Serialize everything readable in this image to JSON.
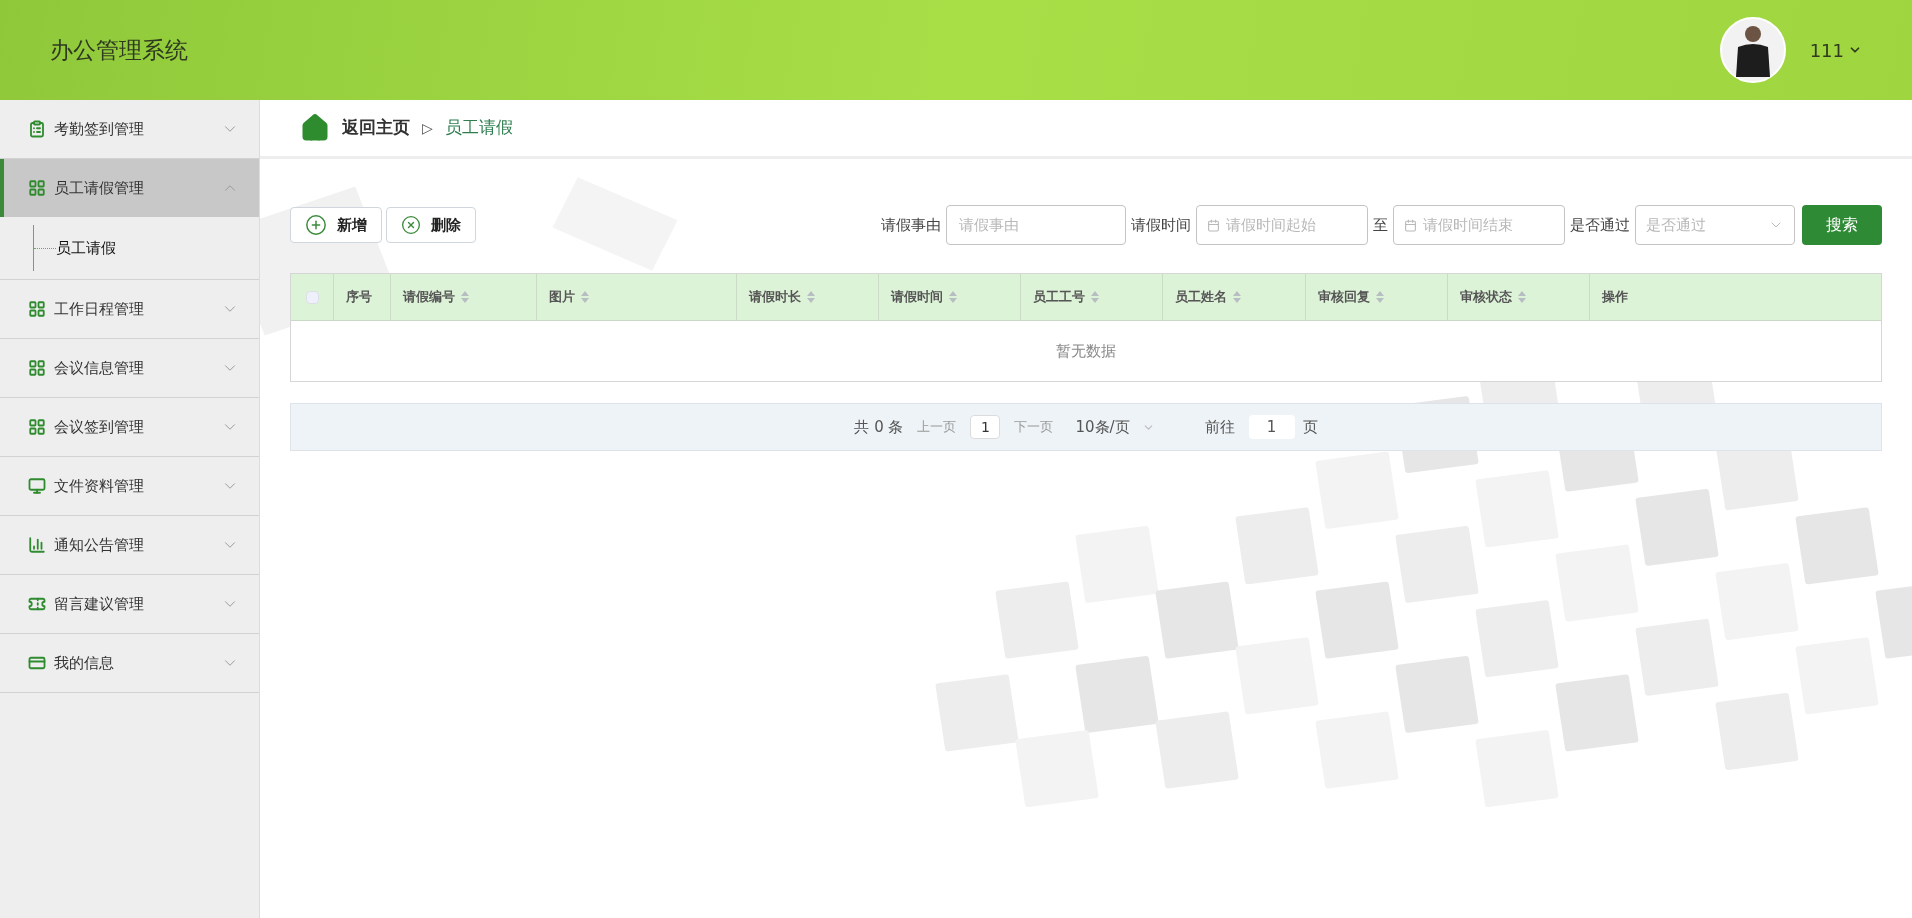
{
  "header": {
    "title": "办公管理系统",
    "user": "111"
  },
  "sidebar": {
    "items": [
      {
        "label": "考勤签到管理",
        "selected": false,
        "expanded": false
      },
      {
        "label": "员工请假管理",
        "selected": true,
        "expanded": true,
        "children": [
          {
            "label": "员工请假",
            "selected": true
          }
        ]
      },
      {
        "label": "工作日程管理",
        "selected": false,
        "expanded": false
      },
      {
        "label": "会议信息管理",
        "selected": false,
        "expanded": false
      },
      {
        "label": "会议签到管理",
        "selected": false,
        "expanded": false
      },
      {
        "label": "文件资料管理",
        "selected": false,
        "expanded": false
      },
      {
        "label": "通知公告管理",
        "selected": false,
        "expanded": false
      },
      {
        "label": "留言建议管理",
        "selected": false,
        "expanded": false
      },
      {
        "label": "我的信息",
        "selected": false,
        "expanded": false
      }
    ]
  },
  "breadcrumb": {
    "home": "返回主页",
    "separator": "▷",
    "current": "员工请假"
  },
  "actions": [
    {
      "kind": "add",
      "label": "新增"
    },
    {
      "kind": "delete",
      "label": "删除"
    }
  ],
  "filters": [
    {
      "kind": "text",
      "label": "请假事由",
      "placeholder": "请假事由"
    },
    {
      "kind": "date",
      "label": "请假时间",
      "placeholder": "请假时间起始"
    },
    {
      "kind": "date",
      "label": "至",
      "placeholder": "请假时间结束"
    },
    {
      "kind": "select",
      "label": "是否通过",
      "placeholder": "是否通过"
    }
  ],
  "search_button": "搜索",
  "table": {
    "columns": [
      {
        "label": "序号",
        "sortable": false
      },
      {
        "label": "请假编号",
        "sortable": true
      },
      {
        "label": "图片",
        "sortable": true
      },
      {
        "label": "请假时长",
        "sortable": true
      },
      {
        "label": "请假时间",
        "sortable": true
      },
      {
        "label": "员工工号",
        "sortable": true
      },
      {
        "label": "员工姓名",
        "sortable": true
      },
      {
        "label": "审核回复",
        "sortable": true
      },
      {
        "label": "审核状态",
        "sortable": true
      },
      {
        "label": "操作",
        "sortable": false
      }
    ],
    "select_all": {
      "checked": false
    },
    "empty_text": "暂无数据"
  },
  "pagination": {
    "total": "共 0 条",
    "prev": "上一页",
    "page": "1",
    "next": "下一页",
    "page_size": "10条/页",
    "goto_label": "前往",
    "goto_value": "1",
    "goto_suffix": "页"
  }
}
